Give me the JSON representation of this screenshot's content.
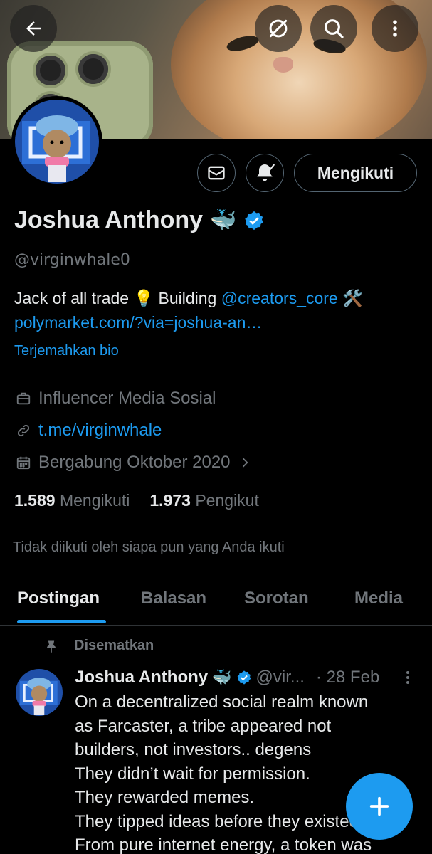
{
  "profile": {
    "name": "Joshua Anthony",
    "name_emoji": "🐳",
    "handle": "@virginwhale0",
    "bio_text": "Jack of all trade 💡 Building ",
    "bio_mention": "@creators_core",
    "bio_tools": " 🛠️",
    "bio_link": "polymarket.com/?via=joshua-an…",
    "translate_bio": "Terjemahkan bio",
    "category": "Influencer Media Sosial",
    "website": "t.me/virginwhale",
    "joined": "Bergabung Oktober 2020",
    "following_count": "1.589",
    "following_label": "Mengikuti",
    "followers_count": "1.973",
    "followers_label": "Pengikut",
    "not_followed": "Tidak diikuti oleh siapa pun yang Anda ikuti"
  },
  "actions": {
    "follow_label": "Mengikuti"
  },
  "tabs": [
    {
      "label": "Postingan"
    },
    {
      "label": "Balasan"
    },
    {
      "label": "Sorotan"
    },
    {
      "label": "Media"
    }
  ],
  "post": {
    "pinned_label": "Disematkan",
    "author_name": "Joshua Anthony",
    "author_emoji": "🐳",
    "author_handle": "@vir...",
    "date": "· 28 Feb",
    "lines": [
      "On a decentralized social realm known",
      "as Farcaster, a tribe appeared not",
      "builders, not investors.. degens",
      "They didn’t wait for permission.",
      "They rewarded memes.",
      "They tipped ideas before they existed.",
      "From pure internet energy, a token was"
    ]
  },
  "colors": {
    "accent": "#1d9bf0",
    "muted": "#71767b",
    "text": "#e7e9ea",
    "background": "#000000"
  },
  "icons": {
    "back": "arrow-left-icon",
    "no_sync": "sync-off-icon",
    "search": "search-icon",
    "more": "more-vertical-icon",
    "message": "mail-icon",
    "notify": "bell-check-icon",
    "verified": "verified-badge-icon",
    "category": "briefcase-icon",
    "website": "link-icon",
    "joined": "calendar-icon",
    "pinned": "pin-icon",
    "compose": "plus-icon"
  }
}
